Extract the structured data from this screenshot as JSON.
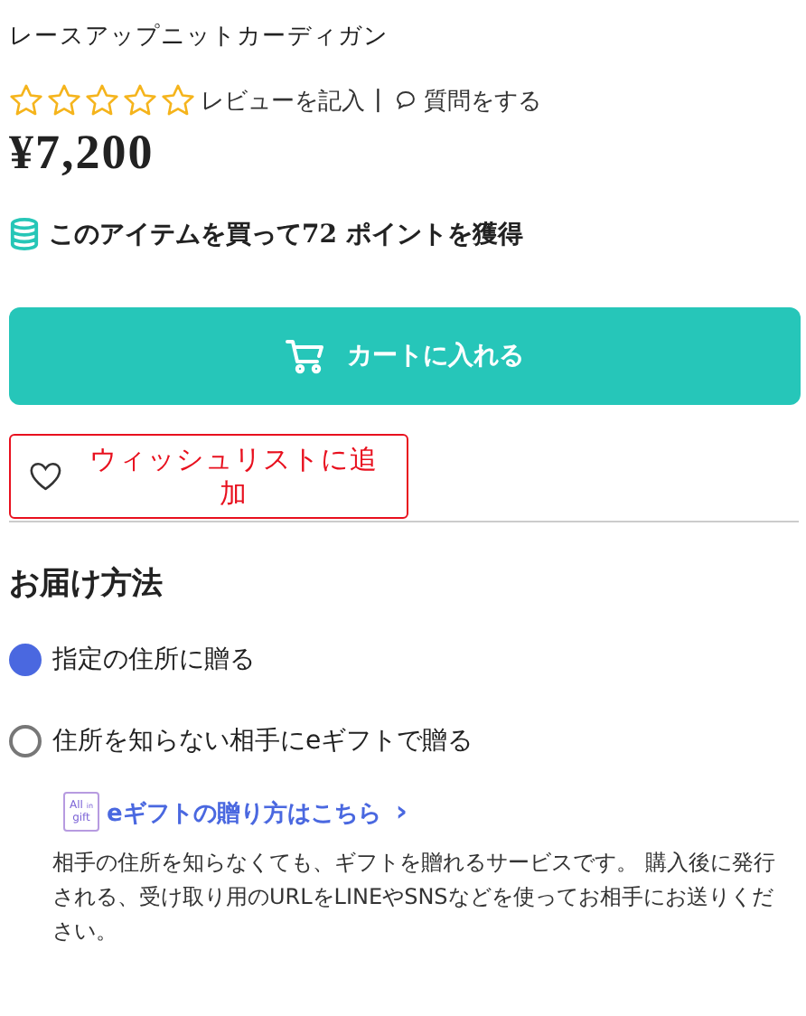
{
  "product": {
    "name": "レースアップニットカーディガン",
    "stars": 0,
    "review_link": "レビューを記入",
    "separator": "|",
    "question_link": "質問をする",
    "price": "¥7,200",
    "points": "このアイテムを買って72 ポイントを獲得"
  },
  "cart_button": "カートに入れる",
  "wishlist_button": "ウィッシュリストに追加",
  "delivery": {
    "heading": "お届け方法",
    "options": [
      {
        "label": "指定の住所に贈る",
        "selected": true
      },
      {
        "label": "住所を知らない相手にeギフトで贈る",
        "selected": false
      }
    ],
    "gift_logo": [
      "All",
      "in",
      "gift"
    ],
    "gift_link": "eギフトの贈り方はこちら",
    "gift_link_arrow": "›",
    "description": "相手の住所を知らなくても、ギフトを贈れるサービスです。 購入後に発行される、受け取り用のURLをLINEやSNSなどを使ってお相手にお送りください。"
  }
}
